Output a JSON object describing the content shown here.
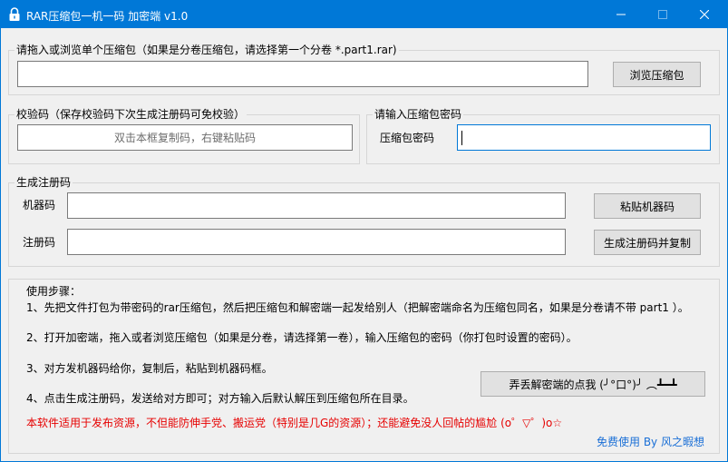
{
  "window": {
    "title": "RAR压缩包一机一码  加密端 v1.0"
  },
  "archive_group": {
    "label": "请拖入或浏览单个压缩包（如果是分卷压缩包，请选择第一个分卷 *.part1.rar)",
    "path_value": "",
    "browse_label": "浏览压缩包"
  },
  "verify_group": {
    "label": "校验码（保存校验码下次生成注册码可免校验）",
    "hint": "双击本框复制码，右键粘贴码"
  },
  "password_group": {
    "label": "请输入压缩包密码",
    "field_label": "压缩包密码",
    "value": ""
  },
  "register_group": {
    "label": "生成注册码",
    "machine_label": "机器码",
    "machine_value": "",
    "paste_label": "粘贴机器码",
    "reg_label": "注册码",
    "reg_value": "",
    "generate_label": "生成注册码并复制"
  },
  "steps": {
    "title": "使用步骤：",
    "step1": "1、先把文件打包为带密码的rar压缩包，然后把压缩包和解密端一起发给别人（把解密端命名为压缩包同名，如果是分卷请不带 part1 ）。",
    "step2": "2、打开加密端，拖入或者浏览压缩包（如果是分卷，请选择第一卷），输入压缩包的密码（你打包时设置的密码）。",
    "step3": "3、对方发机器码给你，复制后，粘贴到机器码框。",
    "step4": "4、点击生成注册码，发送给对方即可；对方输入后默认解压到压缩包所在目录。",
    "warning": "本软件适用于发布资源，不但能防伸手党、搬运党（特别是几G的资源）；还能避免没人回帖的尴尬 (o゜▽゜)o☆",
    "lose_button": "弄丢解密端的点我 (╯°口°)╯ ︵┻━┻",
    "footer": "免费使用 By 风之暇想"
  },
  "colors": {
    "accent": "#0078d7",
    "warning": "#e60000",
    "link": "#1a6fd6"
  }
}
